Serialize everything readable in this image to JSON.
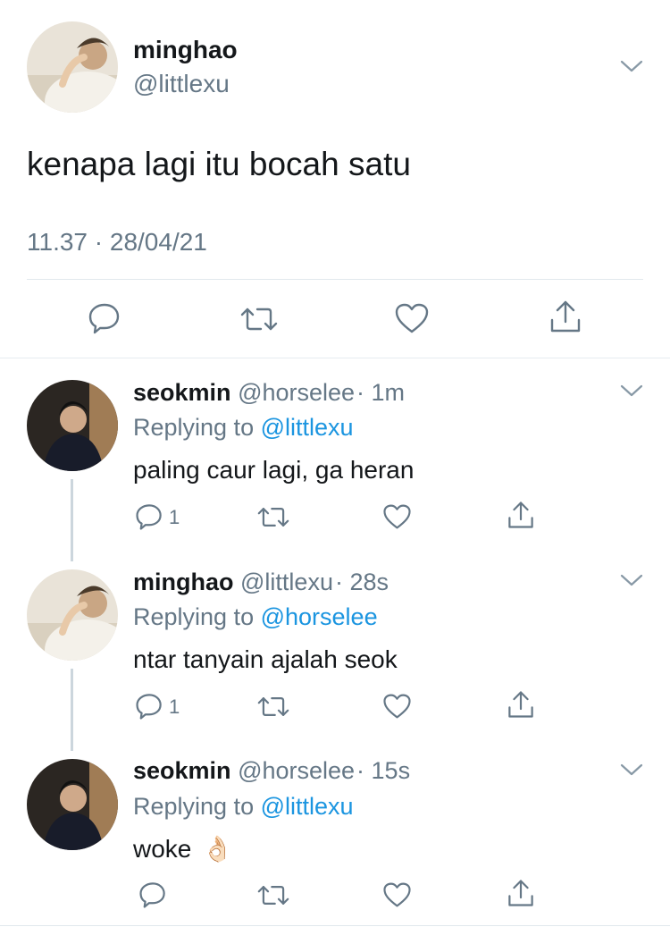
{
  "main_tweet": {
    "display_name": "minghao",
    "handle": "@littlexu",
    "text": "kenapa lagi itu bocah satu",
    "timestamp": "11.37 · 28/04/21"
  },
  "replies": [
    {
      "display_name": "seokmin",
      "handle": "@horselee",
      "time": "· 1m",
      "replying_prefix": "Replying to",
      "replying_to": "@littlexu",
      "text": "paling caur lagi, ga heran",
      "reply_count": "1"
    },
    {
      "display_name": "minghao",
      "handle": "@littlexu",
      "time": "· 28s",
      "replying_prefix": "Replying to",
      "replying_to": "@horselee",
      "text": "ntar tanyain ajalah seok",
      "reply_count": "1"
    },
    {
      "display_name": "seokmin",
      "handle": "@horselee",
      "time": "· 15s",
      "replying_prefix": "Replying to",
      "replying_to": "@littlexu",
      "text": "woke",
      "emoji": "👌🏻",
      "reply_count": ""
    }
  ],
  "icons": {
    "reply": "reply-icon",
    "retweet": "retweet-icon",
    "like": "heart-icon",
    "share": "share-icon",
    "more": "chevron-down-icon"
  },
  "colors": {
    "text": "#14171a",
    "secondary": "#657786",
    "link": "#1b95e0",
    "divider": "#e1e8ed",
    "thread_line": "#ccd6dd"
  }
}
